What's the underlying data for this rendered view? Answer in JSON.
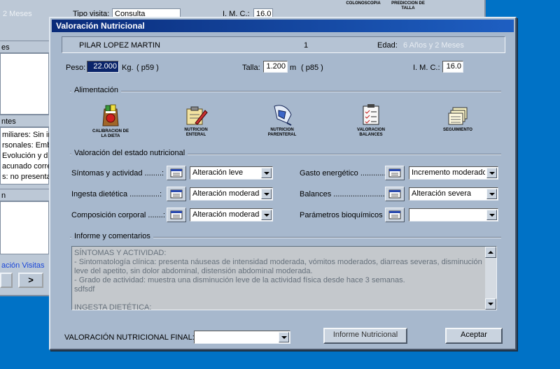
{
  "background": {
    "edad_frag": "2 Meses",
    "tipo_visita_label": "Tipo visita:",
    "tipo_visita_value": "Consulta",
    "imc_label": "I. M. C.:",
    "imc_value": "16.0",
    "icon_caption_1": "COLONOSCOPIA",
    "icon_caption_2": "PREDICCION DE TALLA",
    "section_label_1": "es",
    "section_label_2": "ntes",
    "section_label_3": "n",
    "list_lines": [
      "miliares: Sin int",
      "rsonales: Emba",
      "Evolución y d",
      "acunado corre",
      "s: no presenta"
    ],
    "link_text": "ación Visitas",
    "next_button": ">"
  },
  "dialog": {
    "title": "Valoración Nutricional",
    "patient": {
      "name": "PILAR LOPEZ MARTIN",
      "number": "1",
      "edad_label": "Edad:",
      "edad_value": "6 Años y 2 Meses"
    },
    "peso": {
      "label": "Peso:",
      "value": "22.000",
      "unit": "Kg.",
      "percentile": "( p59 )"
    },
    "talla": {
      "label": "Talla:",
      "value": "1.200",
      "unit": "m",
      "percentile": "( p85 )"
    },
    "imc": {
      "label": "I. M. C.:",
      "value": "16.0"
    },
    "alimentacion": {
      "label": "Alimentación",
      "tools": [
        {
          "icon": "diet-bag-icon",
          "caption": "CALIBRACION DE LA DIETA"
        },
        {
          "icon": "clipboard-pen-icon",
          "caption": "NUTRICION ENTERAL"
        },
        {
          "icon": "iv-bag-icon",
          "caption": "NUTRICION PARENTERAL"
        },
        {
          "icon": "checklist-icon",
          "caption": "VALORACION BALANCES"
        },
        {
          "icon": "stacked-notes-icon",
          "caption": "SEGUIMIENTO"
        }
      ]
    },
    "valoracion": {
      "label": "Valoración del estado nutricional",
      "left": [
        {
          "label": "Síntomas y actividad ........:",
          "value": "Alteración leve"
        },
        {
          "label": "Ingesta dietética ..............:",
          "value": "Alteración moderada"
        },
        {
          "label": "Composición corporal .......:",
          "value": "Alteración moderada"
        }
      ],
      "right": [
        {
          "label": "Gasto energético ............:",
          "value": "Incremento moderado"
        },
        {
          "label": "Balances ........................:",
          "value": "Alteración severa"
        },
        {
          "label": "Parámetros bioquímicos :",
          "value": ""
        }
      ]
    },
    "informe": {
      "label": "Informe y comentarios",
      "text": "SÍNTOMAS Y ACTIVIDAD:\n- Sintomatología clínica: presenta náuseas de intensidad moderada, vómitos moderados, diarreas severas, disminución leve del apetito, sin dolor abdominal, distensión abdominal moderada.\n- Grado de actividad: muestra una disminución leve de la actividad física desde hace 3 semanas.\nsdfsdf\n\nINGESTA DIETÉTICA:"
    },
    "final": {
      "label": "VALORACIÓN NUTRICIONAL FINAL:",
      "value": ""
    },
    "buttons": {
      "informe": "Informe Nutricional",
      "aceptar": "Aceptar"
    }
  }
}
